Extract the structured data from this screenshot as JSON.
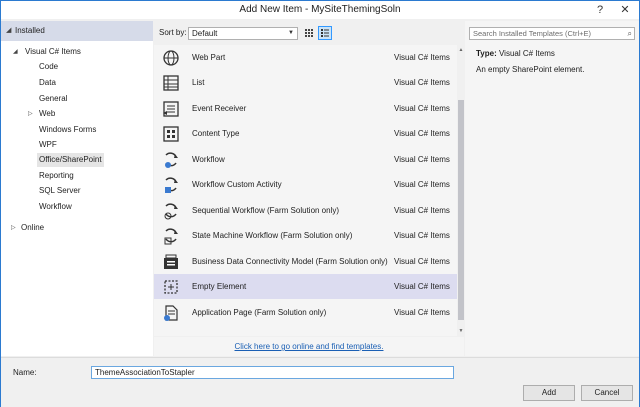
{
  "window": {
    "title": "Add New Item - MySiteThemingSoln",
    "help": "?",
    "close": "✕"
  },
  "tree": {
    "installed": "Installed",
    "visual_cs": "Visual C# Items",
    "children": [
      "Code",
      "Data",
      "General",
      "Web",
      "Windows Forms",
      "WPF",
      "Office/SharePoint",
      "Reporting",
      "SQL Server",
      "Workflow"
    ],
    "selected": "Office/SharePoint",
    "online": "Online"
  },
  "toolbar": {
    "sort_label": "Sort by:",
    "sort_value": "Default"
  },
  "templates": [
    {
      "name": "Web Part",
      "lang": "Visual C# Items",
      "icon": "web-part-icon"
    },
    {
      "name": "List",
      "lang": "Visual C# Items",
      "icon": "list-icon"
    },
    {
      "name": "Event Receiver",
      "lang": "Visual C# Items",
      "icon": "event-receiver-icon"
    },
    {
      "name": "Content Type",
      "lang": "Visual C# Items",
      "icon": "content-type-icon"
    },
    {
      "name": "Workflow",
      "lang": "Visual C# Items",
      "icon": "workflow-icon"
    },
    {
      "name": "Workflow Custom Activity",
      "lang": "Visual C# Items",
      "icon": "workflow-activity-icon"
    },
    {
      "name": "Sequential Workflow (Farm Solution only)",
      "lang": "Visual C# Items",
      "icon": "sequential-workflow-icon"
    },
    {
      "name": "State Machine Workflow (Farm Solution only)",
      "lang": "Visual C# Items",
      "icon": "state-machine-workflow-icon"
    },
    {
      "name": "Business Data Connectivity Model (Farm Solution only)",
      "lang": "Visual C# Items",
      "icon": "bdc-model-icon"
    },
    {
      "name": "Empty Element",
      "lang": "Visual C# Items",
      "icon": "empty-element-icon"
    },
    {
      "name": "Application Page (Farm Solution only)",
      "lang": "Visual C# Items",
      "icon": "application-page-icon"
    }
  ],
  "selected_template": "Empty Element",
  "online_link": "Click here to go online and find templates.",
  "search": {
    "placeholder": "Search Installed Templates (Ctrl+E)"
  },
  "details": {
    "type_label": "Type:",
    "type_value": "Visual C# Items",
    "description": "An empty SharePoint element."
  },
  "name_field": {
    "label": "Name:",
    "value": "ThemeAssociationToStapler"
  },
  "buttons": {
    "add": "Add",
    "cancel": "Cancel"
  },
  "colors": {
    "accent": "#2b7ad0",
    "selection": "#dcdcf0",
    "tree_header": "#d6dbe9",
    "link": "#1a5fb4"
  }
}
